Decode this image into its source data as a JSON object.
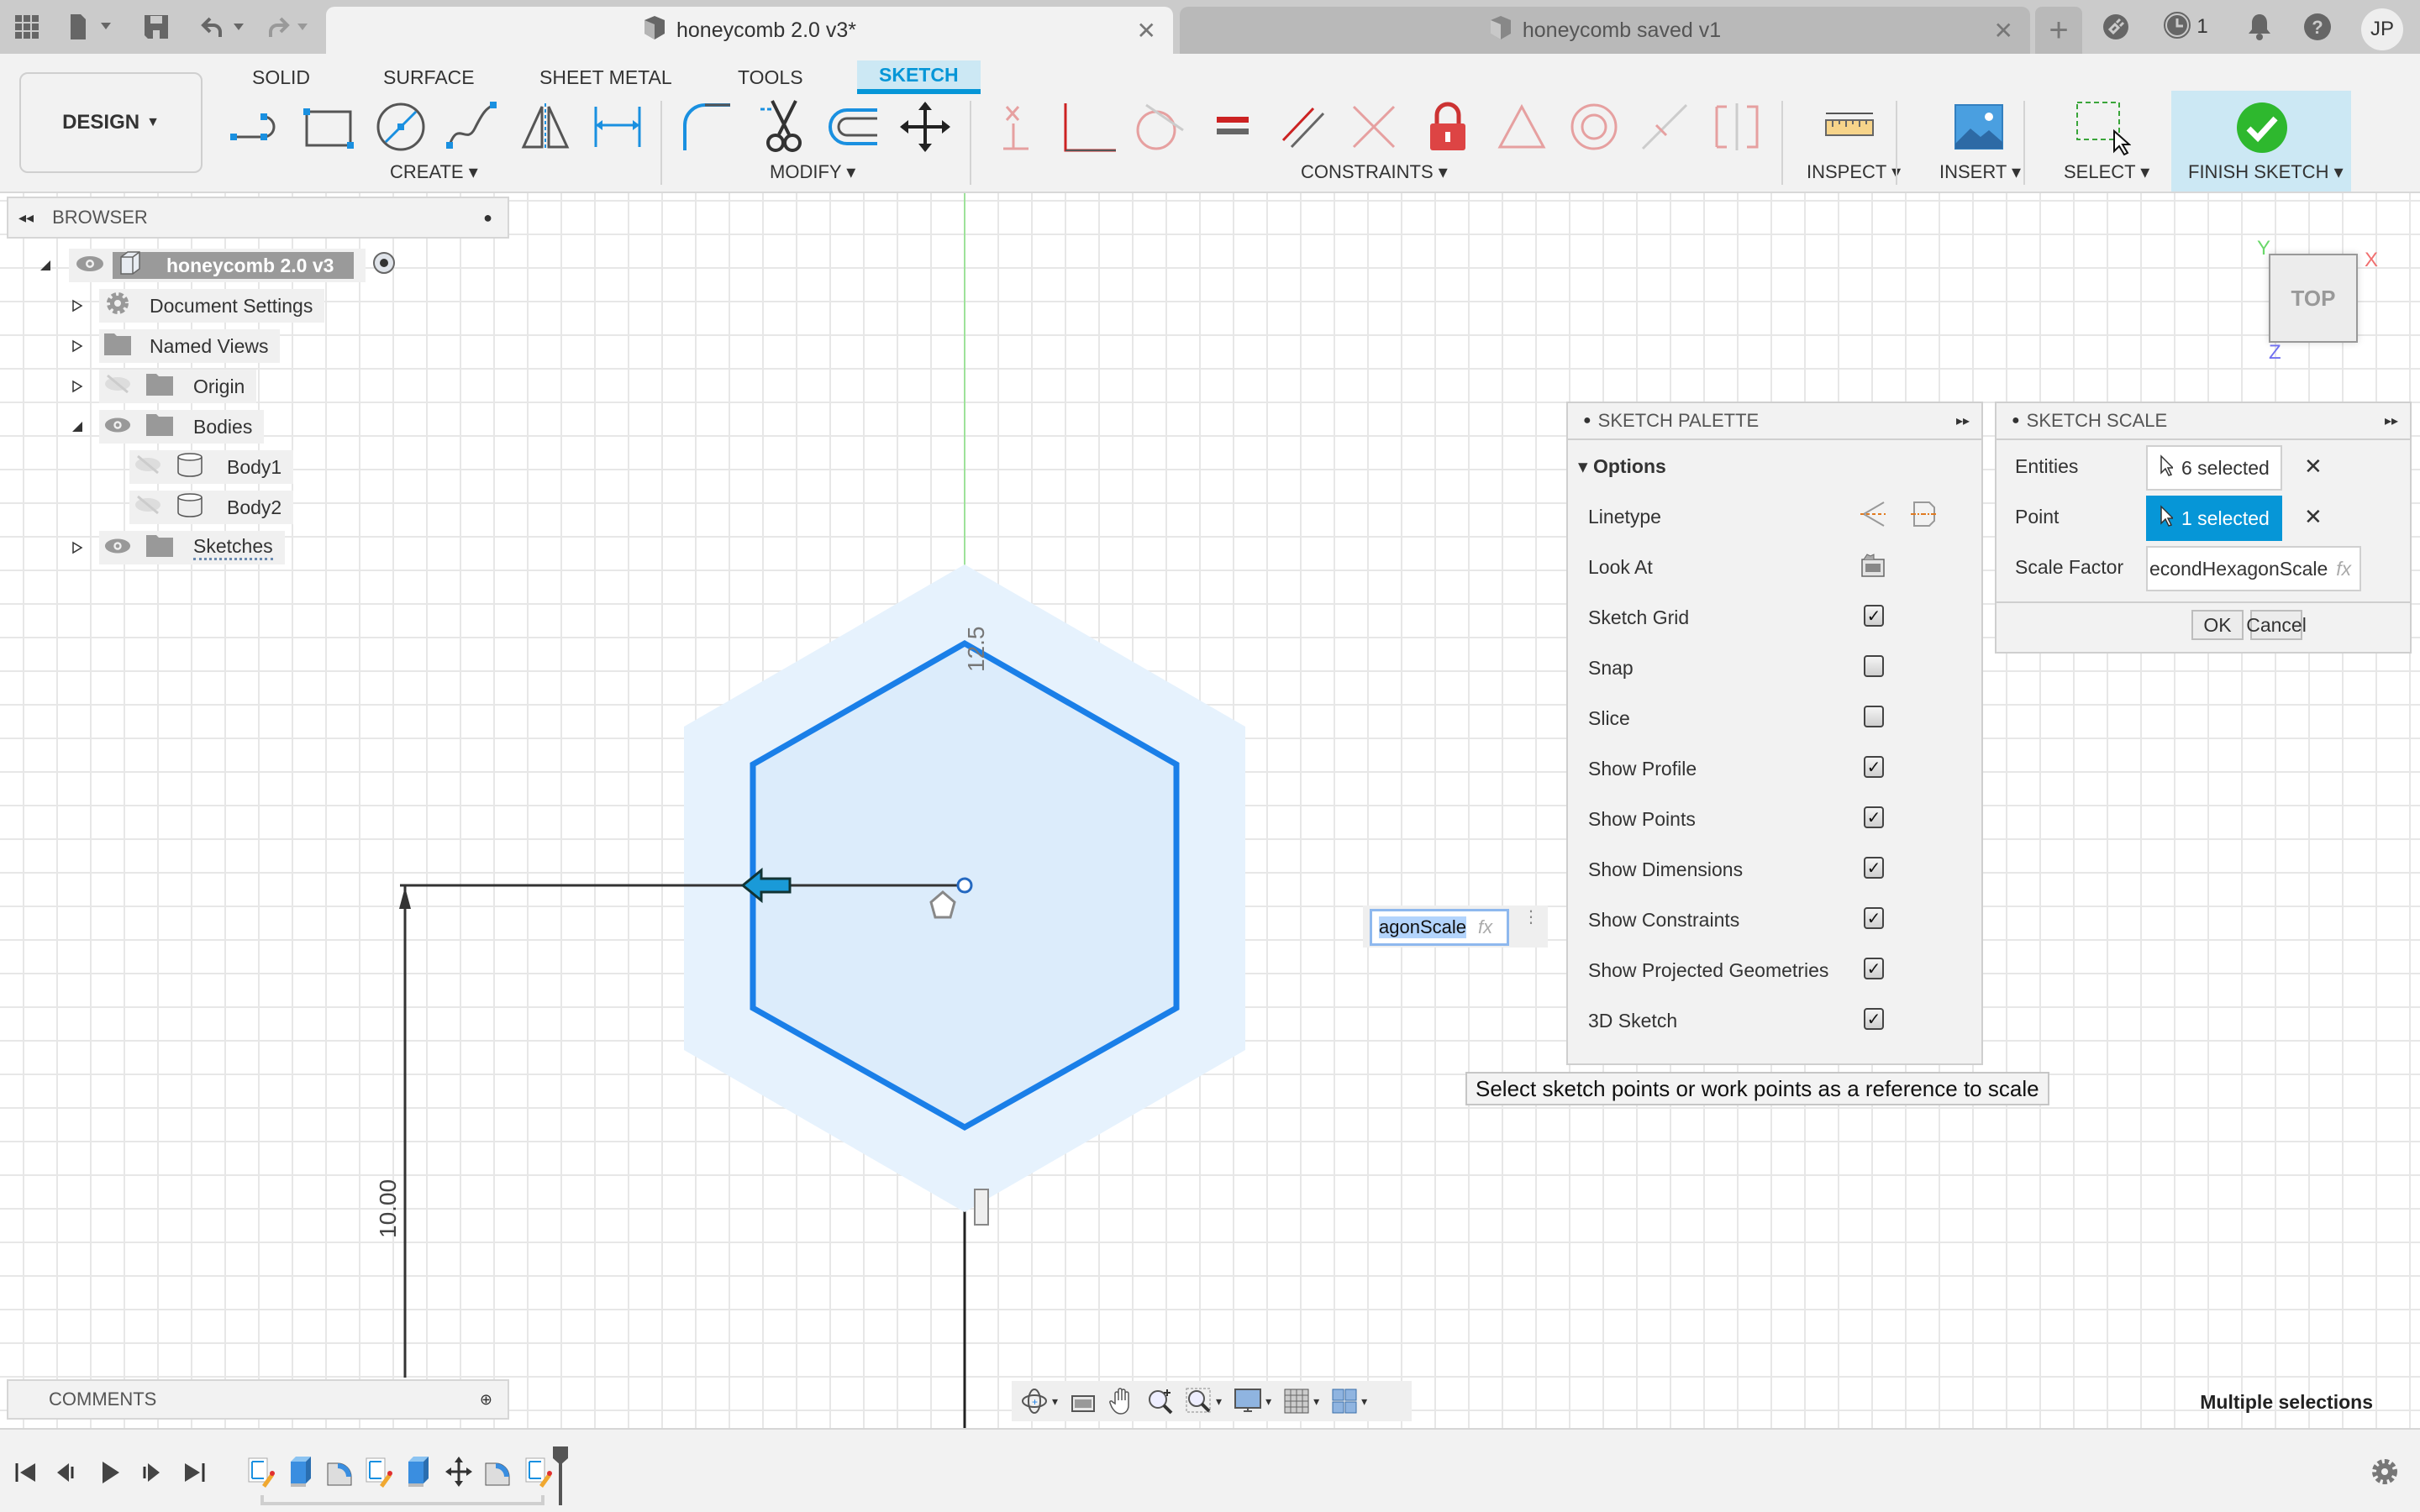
{
  "titlebar": {
    "tabs": [
      {
        "label": "honeycomb 2.0 v3*",
        "active": true
      },
      {
        "label": "honeycomb saved v1",
        "active": false
      }
    ],
    "job_count": "1",
    "user_initials": "JP"
  },
  "ribbon": {
    "workspace": "DESIGN",
    "tabs": [
      "SOLID",
      "SURFACE",
      "SHEET METAL",
      "TOOLS",
      "SKETCH"
    ],
    "active_tab": "SKETCH",
    "groups": {
      "create": "CREATE",
      "modify": "MODIFY",
      "constraints": "CONSTRAINTS",
      "inspect": "INSPECT",
      "insert": "INSERT",
      "select": "SELECT",
      "finish": "FINISH SKETCH"
    }
  },
  "browser": {
    "title": "BROWSER",
    "root": "honeycomb 2.0 v3",
    "items": [
      {
        "label": "Document Settings",
        "icon": "gear-icon"
      },
      {
        "label": "Named Views",
        "icon": "folder-icon"
      },
      {
        "label": "Origin",
        "icon": "folder-icon",
        "visible": false
      },
      {
        "label": "Bodies",
        "icon": "folder-icon",
        "visible": true,
        "expanded": true
      },
      {
        "label": "Body1",
        "icon": "body-icon",
        "visible": false
      },
      {
        "label": "Body2",
        "icon": "body-icon",
        "visible": false
      },
      {
        "label": "Sketches",
        "icon": "folder-icon",
        "visible": true
      }
    ]
  },
  "comments": {
    "title": "COMMENTS"
  },
  "sketch_palette": {
    "title": "SKETCH PALETTE",
    "section": "Options",
    "linetype_label": "Linetype",
    "lookat_label": "Look At",
    "options": [
      {
        "label": "Sketch Grid",
        "checked": true
      },
      {
        "label": "Snap",
        "checked": false
      },
      {
        "label": "Slice",
        "checked": false
      },
      {
        "label": "Show Profile",
        "checked": true
      },
      {
        "label": "Show Points",
        "checked": true
      },
      {
        "label": "Show Dimensions",
        "checked": true
      },
      {
        "label": "Show Constraints",
        "checked": true
      },
      {
        "label": "Show Projected Geometries",
        "checked": true
      },
      {
        "label": "3D Sketch",
        "checked": true
      }
    ],
    "check_glyph": "✓"
  },
  "sketch_scale": {
    "title": "SKETCH SCALE",
    "entities_label": "Entities",
    "entities_value": "6 selected",
    "point_label": "Point",
    "point_value": "1 selected",
    "scale_factor_label": "Scale Factor",
    "scale_factor_value": "econdHexagonScale",
    "fx": "fx",
    "clear_glyph": "✕",
    "ok": "OK",
    "cancel": "Cancel"
  },
  "canvas": {
    "dimension_top": "12.5",
    "dimension_left": "10.00",
    "inline_input_value": "agonScale",
    "inline_input_fx": "fx",
    "tooltip": "Select sketch points or work points as a reference to scale",
    "viewcube_label": "TOP",
    "axes": {
      "x": "X",
      "y": "Y",
      "z": "Z"
    },
    "colors": {
      "sketch_line": "#1a7fe8",
      "profile_fill": "#e6f2fd",
      "y_axis": "#9ee29a"
    }
  },
  "status": {
    "selection": "Multiple selections"
  }
}
